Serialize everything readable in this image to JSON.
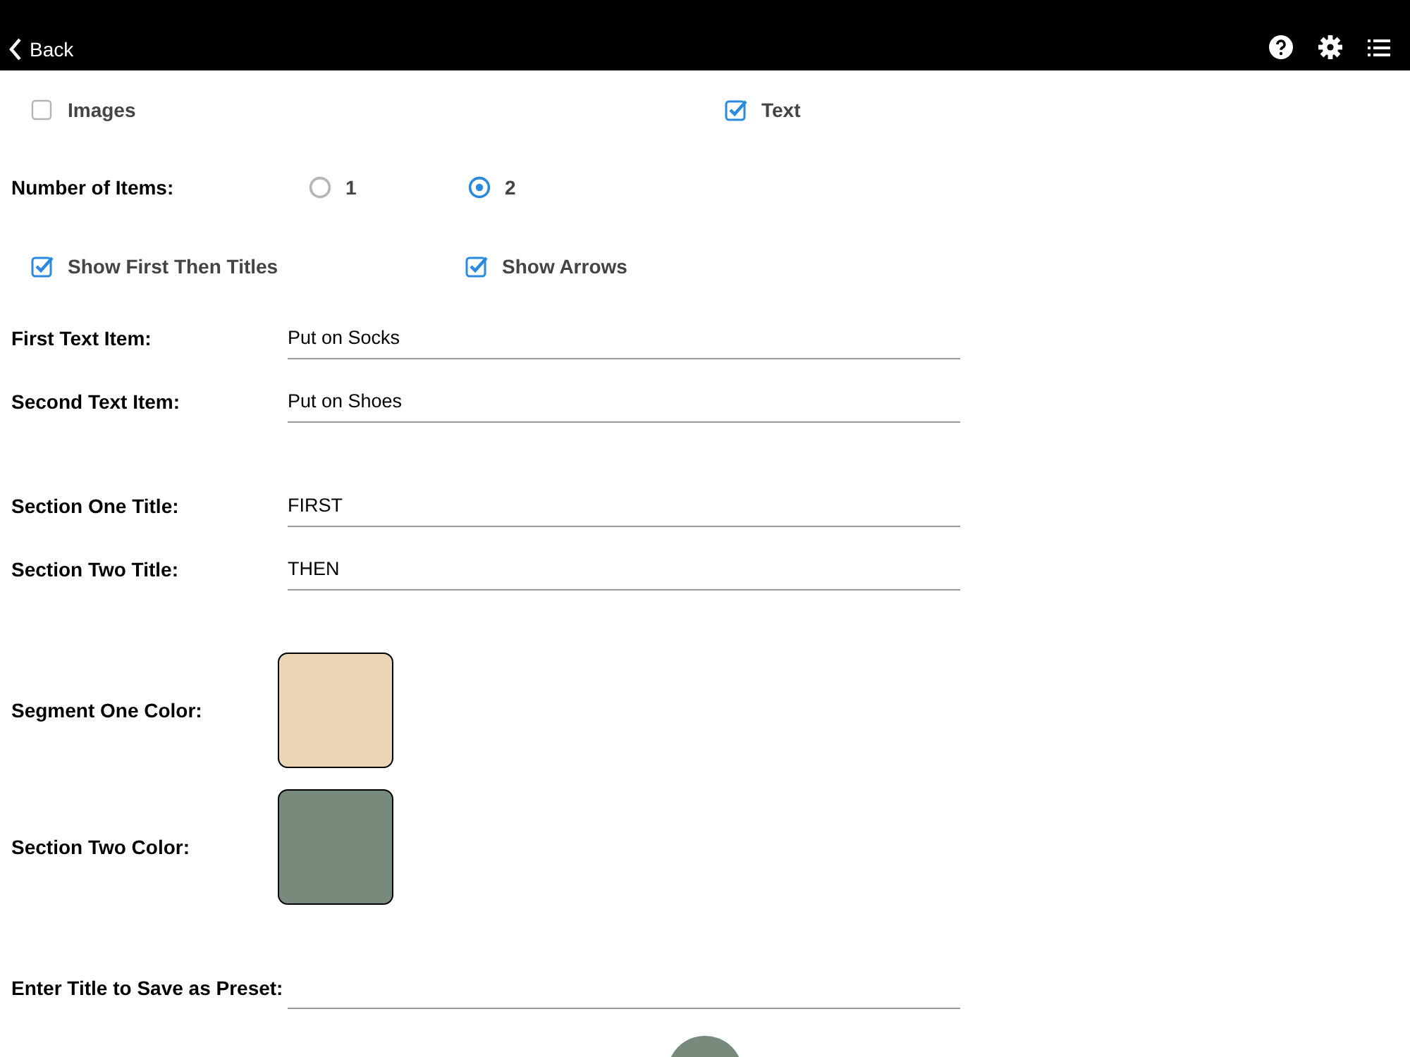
{
  "header": {
    "back": "Back"
  },
  "content_types": [
    {
      "label": "Images",
      "checked": false
    },
    {
      "label": "Text",
      "checked": true
    }
  ],
  "number_of_items": {
    "label": "Number of Items:",
    "options": [
      {
        "label": "1",
        "selected": false
      },
      {
        "label": "2",
        "selected": true
      }
    ]
  },
  "title_options": [
    {
      "label": "Show First Then Titles",
      "checked": true
    },
    {
      "label": "Show Arrows",
      "checked": true
    }
  ],
  "text_items": [
    {
      "label": "First Text Item:",
      "value": "Put on Socks"
    },
    {
      "label": "Second Text Item:",
      "value": "Put on Shoes"
    }
  ],
  "section_titles": [
    {
      "label": "Section One Title:",
      "value": "FIRST"
    },
    {
      "label": "Section Two Title:",
      "value": "THEN"
    }
  ],
  "colors": [
    {
      "label": "Segment One Color:",
      "color": "#ecd5b5"
    },
    {
      "label": "Section Two Color:",
      "color": "#778a7b"
    }
  ],
  "preset": {
    "label": "Enter Title to Save as Preset:"
  }
}
